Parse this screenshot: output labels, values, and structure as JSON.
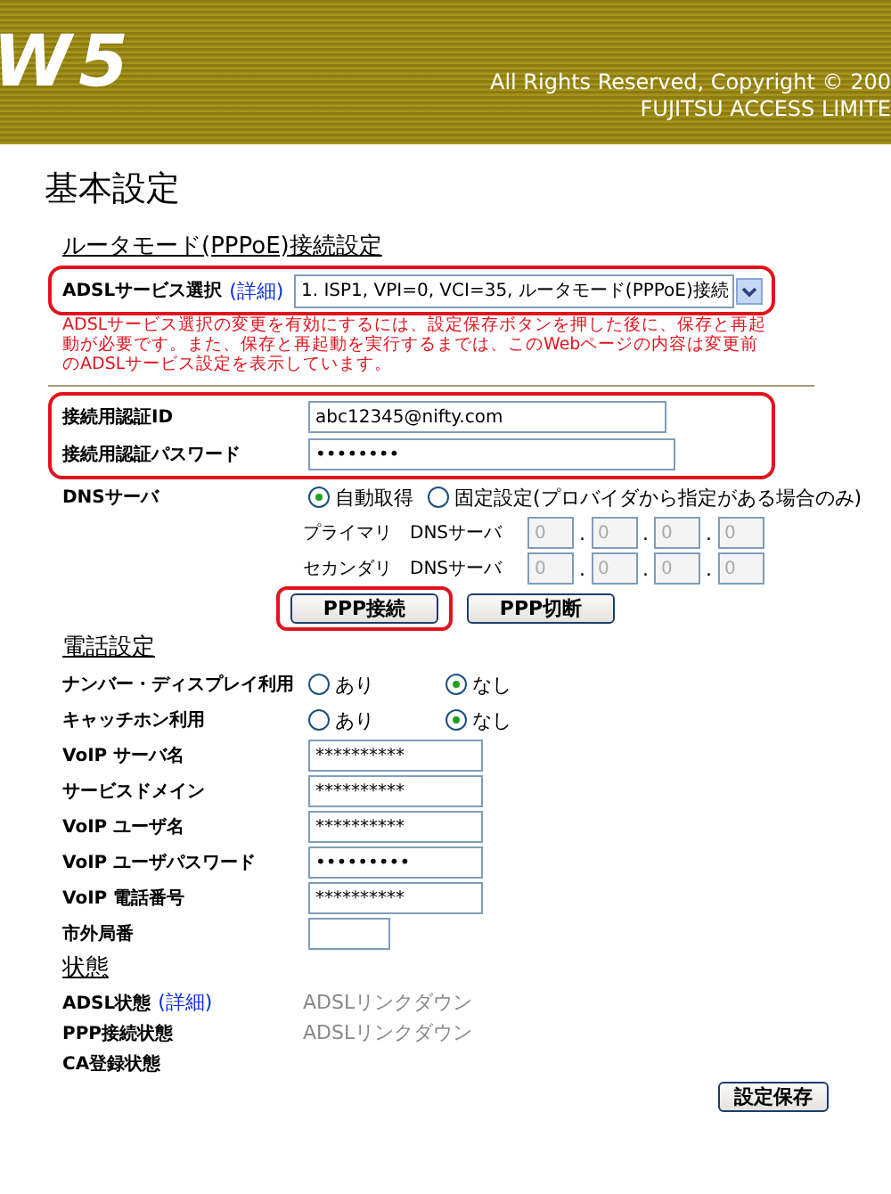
{
  "header": {
    "logo": "W5",
    "copyright": "All Rights Reserved, Copyright © 200",
    "company": "FUJITSU ACCESS LIMITE"
  },
  "page_title": "基本設定",
  "pppoe": {
    "heading": "ルータモード(PPPoE)接続設定",
    "service_select": {
      "label": "ADSLサービス選択",
      "link": "(詳細)",
      "value": "1. ISP1, VPI=0, VCI=35, ルータモード(PPPoE)接続",
      "highlighted": true
    },
    "note": "ADSLサービス選択の変更を有効にするには、設定保存ボタンを押した後に、保存と再起動が必要です。また、保存と再起動を実行するまでは、このWebページの内容は変更前のADSLサービス設定を表示しています。",
    "auth": {
      "highlighted": true,
      "fields": [
        {
          "label": "接続用認証ID",
          "value": "abc12345@nifty.com"
        },
        {
          "label": "接続用認証パスワード",
          "value": "••••••••"
        }
      ]
    },
    "dns": {
      "label": "DNSサーバ",
      "options": [
        {
          "label": "自動取得",
          "selected": true
        },
        {
          "label": "固定設定(プロバイダから指定がある場合のみ)",
          "selected": false
        }
      ],
      "servers": [
        {
          "label": "プライマリ　DNSサーバ",
          "octets": [
            "0",
            "0",
            "0",
            "0"
          ],
          "separators": [
            ".",
            ".",
            "."
          ],
          "disabled": true
        },
        {
          "label": "セカンダリ　DNSサーバ",
          "octets": [
            "0",
            "0",
            "0",
            "0"
          ],
          "separators": [
            ".",
            ".",
            "."
          ],
          "disabled": true
        }
      ]
    },
    "buttons": [
      {
        "label": "PPP接続",
        "highlighted": true
      },
      {
        "label": "PPP切断",
        "highlighted": false
      }
    ]
  },
  "phone": {
    "heading": "電話設定",
    "toggles": [
      {
        "label": "ナンバー・ディスプレイ利用",
        "options": [
          {
            "label": "あり",
            "selected": false
          },
          {
            "label": "なし",
            "selected": true
          }
        ]
      },
      {
        "label": "キャッチホン利用",
        "options": [
          {
            "label": "あり",
            "selected": false
          },
          {
            "label": "なし",
            "selected": true
          }
        ]
      }
    ],
    "fields": [
      {
        "label": "VoIP サーバ名",
        "value": "**********",
        "kind": "text"
      },
      {
        "label": "サービスドメイン",
        "value": "**********",
        "kind": "text"
      },
      {
        "label": "VoIP ユーザ名",
        "value": "**********",
        "kind": "text"
      },
      {
        "label": "VoIP ユーザパスワード",
        "value": "•••••••••",
        "kind": "text"
      },
      {
        "label": "VoIP 電話番号",
        "value": "**********",
        "kind": "text"
      },
      {
        "label": "市外局番",
        "kind": "short"
      }
    ]
  },
  "status": {
    "heading": "状態",
    "rows": [
      {
        "label": "ADSL状態",
        "link": "(詳細)",
        "value": "ADSLリンクダウン"
      },
      {
        "label": "PPP接続状態",
        "value": "ADSLリンクダウン"
      },
      {
        "label": "CA登録状態"
      }
    ]
  },
  "save_button": "設定保存"
}
